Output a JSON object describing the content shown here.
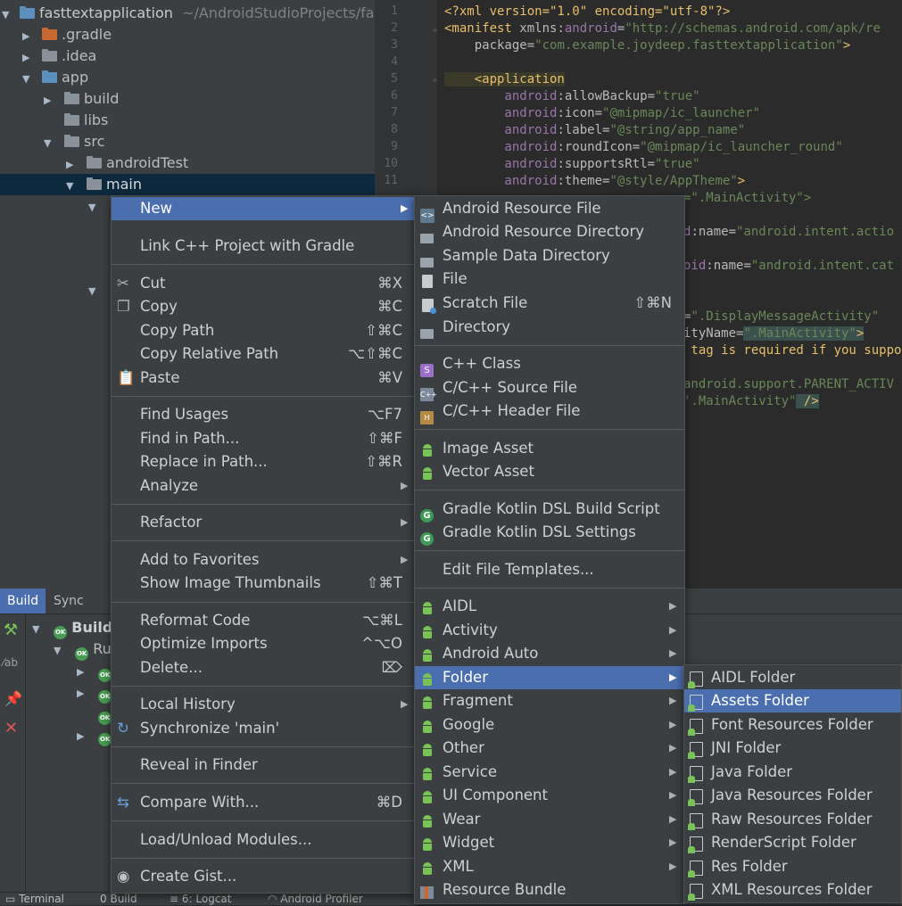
{
  "project_tree": {
    "root_name": "fasttextapplication",
    "root_path": "~/AndroidStudioProjects/fas",
    "items": [
      {
        "label": ".gradle"
      },
      {
        "label": ".idea"
      },
      {
        "label": "app"
      },
      {
        "label": "build"
      },
      {
        "label": "libs"
      },
      {
        "label": "src"
      },
      {
        "label": "androidTest"
      },
      {
        "label": "main"
      }
    ]
  },
  "editor": {
    "line_numbers": [
      "1",
      "2",
      "3",
      "4",
      "5",
      "6",
      "7",
      "8",
      "9",
      "10",
      "11"
    ],
    "lines": {
      "l1": "<?xml version=\"1.0\" encoding=\"utf-8\"?>",
      "l2a": "<manifest ",
      "l2b": "xmlns:",
      "l2c": "android",
      "l2d": "=",
      "l2e": "\"http://schemas.android.com/apk/re",
      "l3a": "    package",
      "l3b": "=",
      "l3c": "\"com.example.joydeep.fasttextapplication\"",
      "l3d": ">",
      "l5": "    <application",
      "l6a": "        android",
      "l6b": ":allowBackup=",
      "l6c": "\"true\"",
      "l7a": "        android",
      "l7b": ":icon=",
      "l7c": "\"@mipmap/ic_launcher\"",
      "l8a": "        android",
      "l8b": ":label=",
      "l8c": "\"@string/app_name\"",
      "l9a": "        android",
      "l9b": ":roundIcon=",
      "l9c": "\"@mipmap/ic_launcher_round\"",
      "l10a": "        android",
      "l10b": ":supportsRtl=",
      "l10c": "\"true\"",
      "l11a": "        android",
      "l11b": ":theme=",
      "l11c": "\"@style/AppTheme\"",
      "l11d": ">",
      "l12": "=\".MainActivity\">",
      "l14a": "d",
      "l14b": ":name=",
      "l14c": "\"android.intent.actio",
      "l16a": "oid",
      "l16b": ":name=",
      "l16c": "\"android.intent.cat",
      "l19a": "=",
      "l19b": "\".DisplayMessageActivity\"",
      "l20a": "ityName=",
      "l20b": "\".MainActivity\"",
      "l20c": ">",
      "l21": " tag is required if you suppo",
      "l23": "android.support.PARENT_ACTIV",
      "l24a": "'.MainActivity\"",
      "l24b": " />"
    }
  },
  "build_panel": {
    "tabs": [
      "Build",
      "Sync"
    ],
    "tree": [
      {
        "label": "Build"
      },
      {
        "label": "Ru"
      }
    ],
    "ok_badge": "OK"
  },
  "statusbar": {
    "items": [
      "Terminal",
      "Build",
      "6: Logcat",
      "Android Profiler"
    ],
    "build_num": "0"
  },
  "context_menu": {
    "new": "New",
    "link_cpp": "Link C++ Project with Gradle",
    "cut": "Cut",
    "cut_sc": "⌘X",
    "copy": "Copy",
    "copy_sc": "⌘C",
    "copy_path": "Copy Path",
    "copy_path_sc": "⇧⌘C",
    "copy_rel": "Copy Relative Path",
    "copy_rel_sc": "⌥⇧⌘C",
    "paste": "Paste",
    "paste_sc": "⌘V",
    "find_usages": "Find Usages",
    "find_usages_sc": "⌥F7",
    "find_path": "Find in Path...",
    "find_path_sc": "⇧⌘F",
    "replace_path": "Replace in Path...",
    "replace_path_sc": "⇧⌘R",
    "analyze": "Analyze",
    "refactor": "Refactor",
    "add_fav": "Add to Favorites",
    "thumbs": "Show Image Thumbnails",
    "thumbs_sc": "⇧⌘T",
    "reformat": "Reformat Code",
    "reformat_sc": "⌥⌘L",
    "optimize": "Optimize Imports",
    "optimize_sc": "^⌥O",
    "delete": "Delete...",
    "delete_sc": "⌦",
    "local_history": "Local History",
    "sync": "Synchronize 'main'",
    "reveal": "Reveal in Finder",
    "compare": "Compare With...",
    "compare_sc": "⌘D",
    "load_unload": "Load/Unload Modules...",
    "gist": "Create Gist..."
  },
  "new_submenu": {
    "android_res_file": "Android Resource File",
    "android_res_dir": "Android Resource Directory",
    "sample_data_dir": "Sample Data Directory",
    "file": "File",
    "scratch": "Scratch File",
    "scratch_sc": "⇧⌘N",
    "directory": "Directory",
    "cpp_class": "C++ Class",
    "cpp_source": "C/C++ Source File",
    "cpp_header": "C/C++ Header File",
    "image_asset": "Image Asset",
    "vector_asset": "Vector Asset",
    "gradle_kotlin_build": "Gradle Kotlin DSL Build Script",
    "gradle_kotlin_settings": "Gradle Kotlin DSL Settings",
    "edit_templates": "Edit File Templates...",
    "aidl": "AIDL",
    "activity": "Activity",
    "android_auto": "Android Auto",
    "folder": "Folder",
    "fragment": "Fragment",
    "google": "Google",
    "other": "Other",
    "service": "Service",
    "ui_component": "UI Component",
    "wear": "Wear",
    "widget": "Widget",
    "xml": "XML",
    "resource_bundle": "Resource Bundle"
  },
  "folder_submenu": {
    "aidl_folder": "AIDL Folder",
    "assets_folder": "Assets Folder",
    "font_res_folder": "Font Resources Folder",
    "jni_folder": "JNI Folder",
    "java_folder": "Java Folder",
    "java_res_folder": "Java Resources Folder",
    "raw_res_folder": "Raw Resources Folder",
    "renderscript_folder": "RenderScript Folder",
    "res_folder": "Res Folder",
    "xml_res_folder": "XML Resources Folder"
  },
  "icons": {
    "c_letter": "S",
    "cpp_src": "C++",
    "h_letter": "H",
    "g_letter": "G"
  },
  "colors": {
    "highlight": "#4b6eaf",
    "menu_bg": "#3c3f41",
    "android_green": "#78c257"
  }
}
